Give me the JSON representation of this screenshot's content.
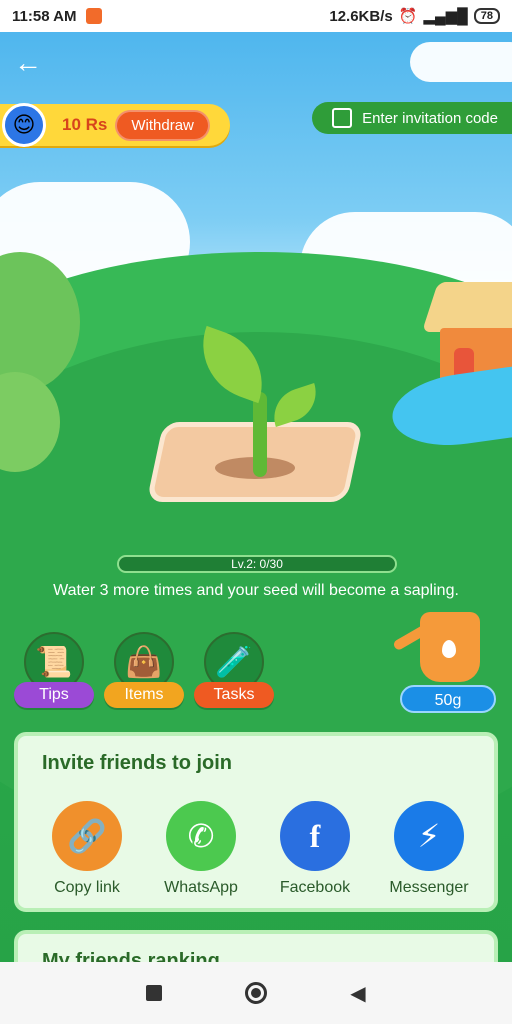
{
  "status_bar": {
    "time": "11:58 AM",
    "network_speed": "12.6KB/s",
    "battery": "78"
  },
  "header": {
    "coin_amount": "10 Rs",
    "withdraw_label": "Withdraw",
    "invitation_label": "Enter invitation code"
  },
  "garden": {
    "level_text": "Lv.2: 0/30",
    "level_progress": 0,
    "hint": "Water 3 more times and your seed will become a sapling."
  },
  "actions": [
    {
      "label": "Tips",
      "color": "#9b4ad6"
    },
    {
      "label": "Items",
      "color": "#f2a51f"
    },
    {
      "label": "Tasks",
      "color": "#ef5a22"
    }
  ],
  "watering": {
    "label": "50g"
  },
  "invite": {
    "title": "Invite friends to join",
    "shares": [
      {
        "label": "Copy link",
        "icon": "link-icon",
        "color": "#f0902c"
      },
      {
        "label": "WhatsApp",
        "icon": "whatsapp-icon",
        "color": "#4cc94f"
      },
      {
        "label": "Facebook",
        "icon": "facebook-icon",
        "color": "#2a6fe0"
      },
      {
        "label": "Messenger",
        "icon": "messenger-icon",
        "color": "#1a7be8"
      }
    ]
  },
  "ranking": {
    "title": "My friends ranking"
  }
}
